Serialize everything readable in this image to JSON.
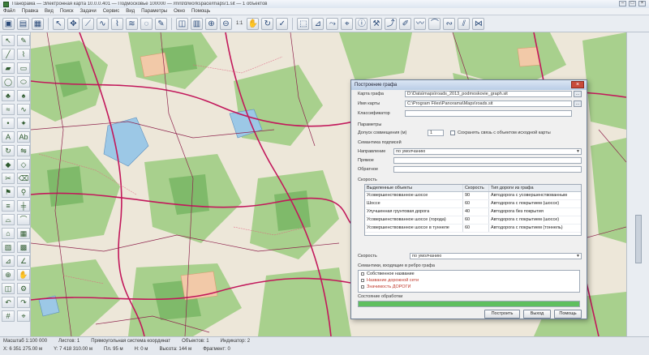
{
  "window": {
    "title": "Панорама — Электронная карта 10.0.0.401 — Подмосковье 100000 — /mnt/d/workspace/maps/1.sit — 1 объектов",
    "min": "–",
    "max": "□",
    "close": "×"
  },
  "menu": [
    "Файл",
    "Правка",
    "Вид",
    "Поиск",
    "Задачи",
    "Сервис",
    "Вид",
    "Параметры",
    "Окно",
    "Помощь"
  ],
  "toolbar": {
    "scale": "1:1"
  },
  "dialog": {
    "title": "Построение графа",
    "fields": {
      "map_name_label": "Карта графа",
      "map_name_value": "D:\\Data\\maps\\roads_2013_podmoskovie_graph.sit",
      "source_label": "Имя карты",
      "source_value": "C:\\Program Files\\Panorama\\Maps\\roads.sit",
      "classifier_label": "Классификатор",
      "params_label": "Параметры",
      "tolerance_label": "Допуск совмещения (м)",
      "tolerance_value": "1",
      "keep_label": "Сохранять связь с объектом исходной карты",
      "semantic_label": "Семантика подписей",
      "direction_label": "Направление",
      "direction_value": "по умолчанию",
      "straight_label": "Прямое",
      "reverse_label": "Обратное",
      "speed_label": "Скорость",
      "speed_value": "по умолчанию",
      "semantic_list_label": "Семантики, входящие в ребро графа",
      "status_label": "Состояние обработки"
    },
    "table": {
      "headers": [
        "Выделенные объекты",
        "Скорость",
        "Тип дороги из графа"
      ],
      "rows": [
        [
          "Усовершенствованное шоссе",
          "90",
          "Автодорога с усовершенствованным"
        ],
        [
          "Шоссе",
          "60",
          "Автодорога с покрытием (шоссе)"
        ],
        [
          "Улучшенная грунтовая дорога",
          "40",
          "Автодорога без покрытия"
        ],
        [
          "Усовершенствованное шоссе (города)",
          "60",
          "Автодорога с покрытием (шоссе)"
        ],
        [
          "Усовершенствованное шоссе в туннеле",
          "60",
          "Автодорога с покрытием (тоннель)"
        ]
      ]
    },
    "semantic_items": [
      {
        "text": "Собственное название",
        "color": "#222222"
      },
      {
        "text": "Название дорожной сети",
        "color": "#c0392b"
      },
      {
        "text": "Значимость ДОРОГИ",
        "color": "#c0392b"
      }
    ],
    "progress": 1.0,
    "buttons": {
      "build": "Построить",
      "exit": "Выход",
      "help": "Помощь"
    }
  },
  "status": {
    "row1": [
      "Масштаб 1:100 000",
      "Листов: 1",
      "Прямоугольная система координат",
      "Объектов: 1",
      "Индикатор: 2"
    ],
    "row2": [
      "X: 6 351 275.00 м",
      "Y: 7 418 310.00 м",
      "Пл. 95 м",
      "Н: 0 м",
      "Высота: 144 м",
      "Фрагмент: 0"
    ]
  }
}
